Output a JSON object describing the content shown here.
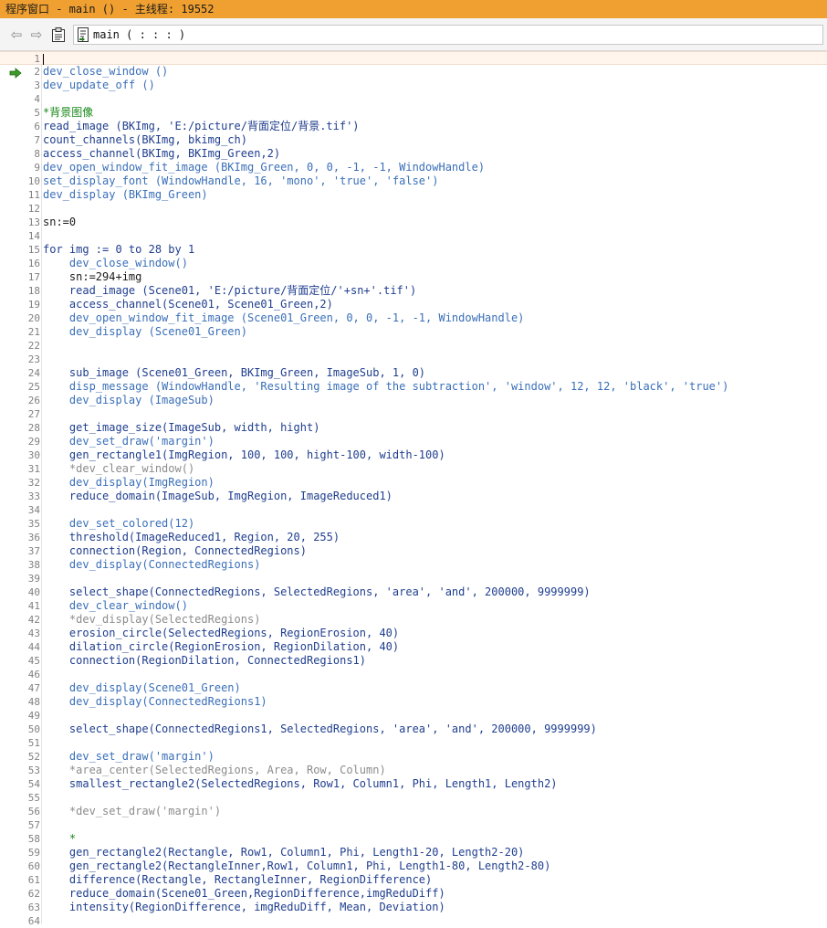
{
  "window": {
    "title": "程序窗口 - main () - 主线程: 19552"
  },
  "toolbar": {
    "procedure_label": "main ( : : : )"
  },
  "icons": {
    "back": "arrow-left-icon",
    "forward": "arrow-right-icon",
    "clipboard": "clipboard-icon",
    "procedure": "procedure-icon",
    "pc": "program-counter-arrow-icon"
  },
  "colors": {
    "titlebar": "#f0a030",
    "operator": "#1f3e8e",
    "dev_operator": "#3a6fb8",
    "comment": "#8c8c8c",
    "comment_green": "#1a8a1a",
    "current_line": "#fff5ec"
  },
  "current_line": 1,
  "pc_line": 2,
  "lines": [
    {
      "n": "1",
      "text": "",
      "kind": "op"
    },
    {
      "n": "2",
      "text": "dev_close_window ()",
      "kind": "dev"
    },
    {
      "n": "3",
      "text": "dev_update_off ()",
      "kind": "dev"
    },
    {
      "n": "4",
      "text": "",
      "kind": "op"
    },
    {
      "n": "5",
      "text": "*背景图像",
      "kind": "comment-green"
    },
    {
      "n": "6",
      "text": "read_image (BKImg, 'E:/picture/背面定位/背景.tif')",
      "kind": "op"
    },
    {
      "n": "7",
      "text": "count_channels(BKImg, bkimg_ch)",
      "kind": "op"
    },
    {
      "n": "8",
      "text": "access_channel(BKImg, BKImg_Green,2)",
      "kind": "op"
    },
    {
      "n": "9",
      "text": "dev_open_window_fit_image (BKImg_Green, 0, 0, -1, -1, WindowHandle)",
      "kind": "dev"
    },
    {
      "n": "10",
      "text": "set_display_font (WindowHandle, 16, 'mono', 'true', 'false')",
      "kind": "dev"
    },
    {
      "n": "11",
      "text": "dev_display (BKImg_Green)",
      "kind": "dev"
    },
    {
      "n": "12",
      "text": "",
      "kind": "op"
    },
    {
      "n": "13",
      "text": "sn:=0",
      "kind": "assign"
    },
    {
      "n": "14",
      "text": "",
      "kind": "op"
    },
    {
      "n": "15",
      "text": "for img := 0 to 28 by 1",
      "kind": "ctrl"
    },
    {
      "n": "16",
      "text": "    dev_close_window()",
      "kind": "dev"
    },
    {
      "n": "17",
      "text": "    sn:=294+img",
      "kind": "assign"
    },
    {
      "n": "18",
      "text": "    read_image (Scene01, 'E:/picture/背面定位/'+sn+'.tif')",
      "kind": "op"
    },
    {
      "n": "19",
      "text": "    access_channel(Scene01, Scene01_Green,2)",
      "kind": "op"
    },
    {
      "n": "20",
      "text": "    dev_open_window_fit_image (Scene01_Green, 0, 0, -1, -1, WindowHandle)",
      "kind": "dev"
    },
    {
      "n": "21",
      "text": "    dev_display (Scene01_Green)",
      "kind": "dev"
    },
    {
      "n": "22",
      "text": "",
      "kind": "op"
    },
    {
      "n": "23",
      "text": "",
      "kind": "op"
    },
    {
      "n": "24",
      "text": "    sub_image (Scene01_Green, BKImg_Green, ImageSub, 1, 0)",
      "kind": "op"
    },
    {
      "n": "25",
      "text": "    disp_message (WindowHandle, 'Resulting image of the subtraction', 'window', 12, 12, 'black', 'true')",
      "kind": "dev"
    },
    {
      "n": "26",
      "text": "    dev_display (ImageSub)",
      "kind": "dev"
    },
    {
      "n": "27",
      "text": "",
      "kind": "op"
    },
    {
      "n": "28",
      "text": "    get_image_size(ImageSub, width, hight)",
      "kind": "op"
    },
    {
      "n": "29",
      "text": "    dev_set_draw('margin')",
      "kind": "dev"
    },
    {
      "n": "30",
      "text": "    gen_rectangle1(ImgRegion, 100, 100, hight-100, width-100)",
      "kind": "op"
    },
    {
      "n": "31",
      "text": "    *dev_clear_window()",
      "kind": "comment"
    },
    {
      "n": "32",
      "text": "    dev_display(ImgRegion)",
      "kind": "dev"
    },
    {
      "n": "33",
      "text": "    reduce_domain(ImageSub, ImgRegion, ImageReduced1)",
      "kind": "op"
    },
    {
      "n": "34",
      "text": "",
      "kind": "op"
    },
    {
      "n": "35",
      "text": "    dev_set_colored(12)",
      "kind": "dev"
    },
    {
      "n": "36",
      "text": "    threshold(ImageReduced1, Region, 20, 255)",
      "kind": "op"
    },
    {
      "n": "37",
      "text": "    connection(Region, ConnectedRegions)",
      "kind": "op"
    },
    {
      "n": "38",
      "text": "    dev_display(ConnectedRegions)",
      "kind": "dev"
    },
    {
      "n": "39",
      "text": "",
      "kind": "op"
    },
    {
      "n": "40",
      "text": "    select_shape(ConnectedRegions, SelectedRegions, 'area', 'and', 200000, 9999999)",
      "kind": "op"
    },
    {
      "n": "41",
      "text": "    dev_clear_window()",
      "kind": "dev"
    },
    {
      "n": "42",
      "text": "    *dev_display(SelectedRegions)",
      "kind": "comment"
    },
    {
      "n": "43",
      "text": "    erosion_circle(SelectedRegions, RegionErosion, 40)",
      "kind": "op"
    },
    {
      "n": "44",
      "text": "    dilation_circle(RegionErosion, RegionDilation, 40)",
      "kind": "op"
    },
    {
      "n": "45",
      "text": "    connection(RegionDilation, ConnectedRegions1)",
      "kind": "op"
    },
    {
      "n": "46",
      "text": "",
      "kind": "op"
    },
    {
      "n": "47",
      "text": "    dev_display(Scene01_Green)",
      "kind": "dev"
    },
    {
      "n": "48",
      "text": "    dev_display(ConnectedRegions1)",
      "kind": "dev"
    },
    {
      "n": "49",
      "text": "",
      "kind": "op"
    },
    {
      "n": "50",
      "text": "    select_shape(ConnectedRegions1, SelectedRegions, 'area', 'and', 200000, 9999999)",
      "kind": "op"
    },
    {
      "n": "51",
      "text": "",
      "kind": "op"
    },
    {
      "n": "52",
      "text": "    dev_set_draw('margin')",
      "kind": "dev"
    },
    {
      "n": "53",
      "text": "    *area_center(SelectedRegions, Area, Row, Column)",
      "kind": "comment"
    },
    {
      "n": "54",
      "text": "    smallest_rectangle2(SelectedRegions, Row1, Column1, Phi, Length1, Length2)",
      "kind": "op"
    },
    {
      "n": "55",
      "text": "",
      "kind": "op"
    },
    {
      "n": "56",
      "text": "    *dev_set_draw('margin')",
      "kind": "comment"
    },
    {
      "n": "57",
      "text": "",
      "kind": "op"
    },
    {
      "n": "58",
      "text": "    *",
      "kind": "comment-green"
    },
    {
      "n": "59",
      "text": "    gen_rectangle2(Rectangle, Row1, Column1, Phi, Length1-20, Length2-20)",
      "kind": "op"
    },
    {
      "n": "60",
      "text": "    gen_rectangle2(RectangleInner,Row1, Column1, Phi, Length1-80, Length2-80)",
      "kind": "op"
    },
    {
      "n": "61",
      "text": "    difference(Rectangle, RectangleInner, RegionDifference)",
      "kind": "op"
    },
    {
      "n": "62",
      "text": "    reduce_domain(Scene01_Green,RegionDifference,imgReduDiff)",
      "kind": "op"
    },
    {
      "n": "63",
      "text": "    intensity(RegionDifference, imgReduDiff, Mean, Deviation)",
      "kind": "op"
    },
    {
      "n": "64",
      "text": "",
      "kind": "op"
    }
  ]
}
